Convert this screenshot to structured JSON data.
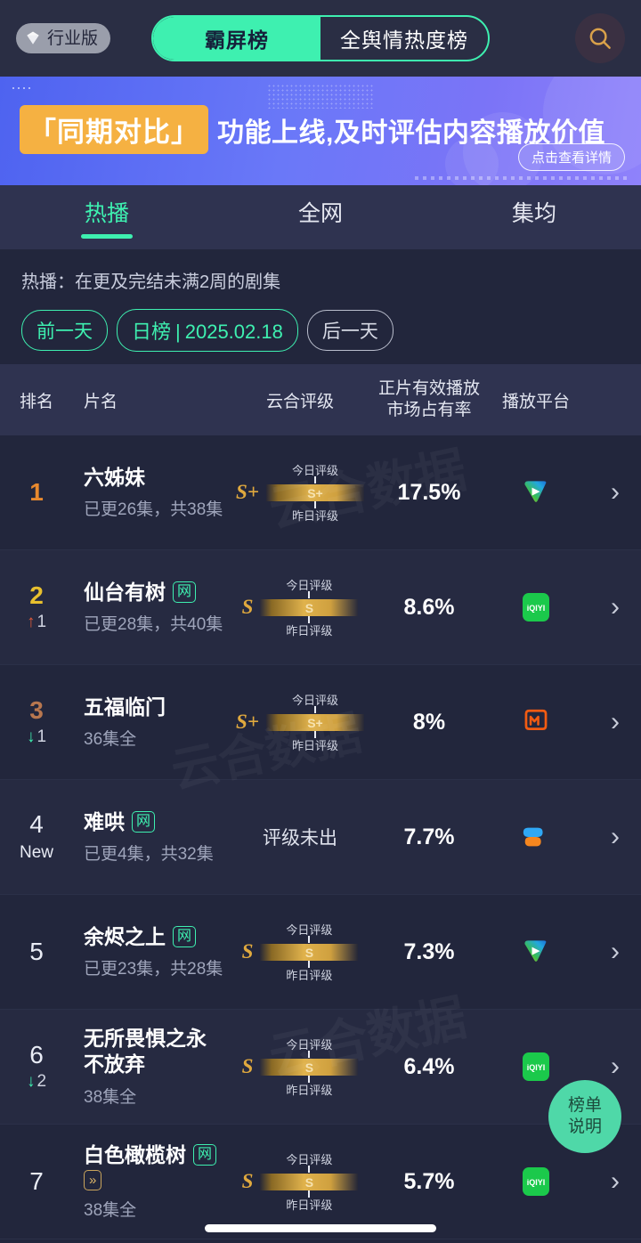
{
  "topbar": {
    "pro_badge": {
      "label": "行业版",
      "icon": "gem-icon"
    },
    "segments": [
      {
        "label": "霸屏榜",
        "active": true
      },
      {
        "label": "全舆情热度榜",
        "active": false
      }
    ],
    "search_icon": "search-icon",
    "accent": "#3ef0b0"
  },
  "banner": {
    "tag": "「同期对比」",
    "text": "功能上线,及时评估内容播放价值",
    "cta": "点击查看详情",
    "tag_color": "#f5b142",
    "bg_color": "#5c6ef4"
  },
  "tabs": [
    {
      "label": "热播",
      "active": true
    },
    {
      "label": "全网",
      "active": false
    },
    {
      "label": "集均",
      "active": false
    }
  ],
  "filter": {
    "description": "热播：在更及完结未满2周的剧集",
    "prev_day": "前一天",
    "rank_type": "日榜",
    "date": "2025.02.18",
    "next_day": "后一天"
  },
  "table": {
    "headers": {
      "rank": "排名",
      "title": "片名",
      "grade": "云合评级",
      "share_line1": "正片有效播放",
      "share_line2": "市场占有率",
      "platform": "播放平台"
    },
    "grade_labels": {
      "today": "今日评级",
      "yesterday": "昨日评级"
    },
    "rows": [
      {
        "rank": "1",
        "rank_change_dir": "none",
        "rank_change_value": "",
        "is_new": false,
        "title": "六姊妹",
        "net_badge": "",
        "fast_forward_badge": "",
        "episodes": "已更26集，共38集",
        "grade_letter": "S+",
        "grade_bar_value": "S+",
        "no_grade_text": "",
        "share": "17.5%",
        "platform": "tencent-video"
      },
      {
        "rank": "2",
        "rank_change_dir": "up",
        "rank_change_value": "1",
        "is_new": false,
        "title": "仙台有树",
        "net_badge": "网",
        "fast_forward_badge": "",
        "episodes": "已更28集，共40集",
        "grade_letter": "S",
        "grade_bar_value": "S",
        "no_grade_text": "",
        "share": "8.6%",
        "platform": "iqiyi"
      },
      {
        "rank": "3",
        "rank_change_dir": "down",
        "rank_change_value": "1",
        "is_new": false,
        "title": "五福临门",
        "net_badge": "",
        "fast_forward_badge": "",
        "episodes": "36集全",
        "grade_letter": "S+",
        "grade_bar_value": "S+",
        "no_grade_text": "",
        "share": "8%",
        "platform": "mango-tv"
      },
      {
        "rank": "4",
        "rank_change_dir": "none",
        "rank_change_value": "",
        "is_new": true,
        "new_label": "New",
        "title": "难哄",
        "net_badge": "网",
        "fast_forward_badge": "",
        "episodes": "已更4集，共32集",
        "grade_letter": "",
        "grade_bar_value": "",
        "no_grade_text": "评级未出",
        "share": "7.7%",
        "platform": "youku"
      },
      {
        "rank": "5",
        "rank_change_dir": "none",
        "rank_change_value": "",
        "is_new": false,
        "title": "余烬之上",
        "net_badge": "网",
        "fast_forward_badge": "",
        "episodes": "已更23集，共28集",
        "grade_letter": "S",
        "grade_bar_value": "S",
        "no_grade_text": "",
        "share": "7.3%",
        "platform": "tencent-video"
      },
      {
        "rank": "6",
        "rank_change_dir": "down",
        "rank_change_value": "2",
        "is_new": false,
        "title": "无所畏惧之永不放弃",
        "net_badge": "",
        "fast_forward_badge": "",
        "episodes": "38集全",
        "grade_letter": "S",
        "grade_bar_value": "S",
        "no_grade_text": "",
        "share": "6.4%",
        "platform": "iqiyi"
      },
      {
        "rank": "7",
        "rank_change_dir": "none",
        "rank_change_value": "",
        "is_new": false,
        "title": "白色橄榄树",
        "net_badge": "网",
        "fast_forward_badge": "》》",
        "episodes": "38集全",
        "grade_letter": "S",
        "grade_bar_value": "S",
        "no_grade_text": "",
        "share": "5.7%",
        "platform": "iqiyi"
      }
    ]
  },
  "fab": {
    "line1": "榜单",
    "line2": "说明"
  },
  "watermark": {
    "text": "云合数据"
  }
}
